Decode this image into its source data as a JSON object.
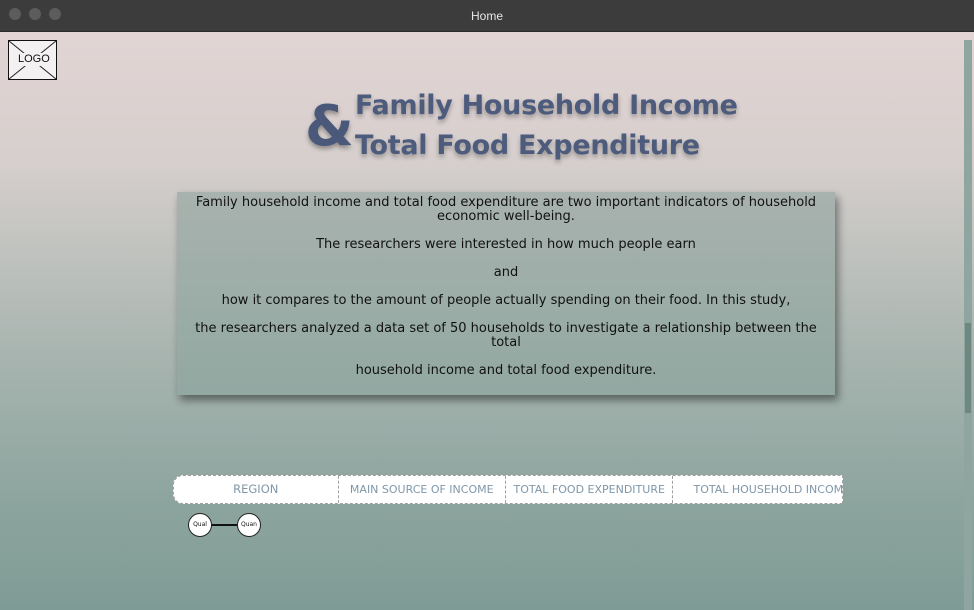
{
  "window": {
    "title": "Home"
  },
  "logo": {
    "label": "LOGO"
  },
  "heading": {
    "ampersand": "&",
    "line1": "Family Household Income",
    "line2": "Total Food Expenditure"
  },
  "intro": {
    "paragraphs": [
      "Family household income and total food expenditure are two important indicators of household economic well-being.",
      "The researchers were interested in how much people earn",
      "and",
      "how it compares to the amount of people actually spending on their food. In this study,",
      "the researchers analyzed a data set of 50 households to investigate a relationship between the total",
      "household income and total food expenditure."
    ]
  },
  "tabs": [
    {
      "label": "REGION"
    },
    {
      "label": "MAIN SOURCE OF INCOME"
    },
    {
      "label": "TOTAL FOOD EXPENDITURE"
    },
    {
      "label": "TOTAL HOUSEHOLD INCOME"
    }
  ],
  "legend": {
    "qual": "Qual",
    "quan": "Quan"
  },
  "colors": {
    "heading": "#4d5b7c",
    "tab_text": "#7f97a9",
    "titlebar": "#3c3c3c"
  }
}
